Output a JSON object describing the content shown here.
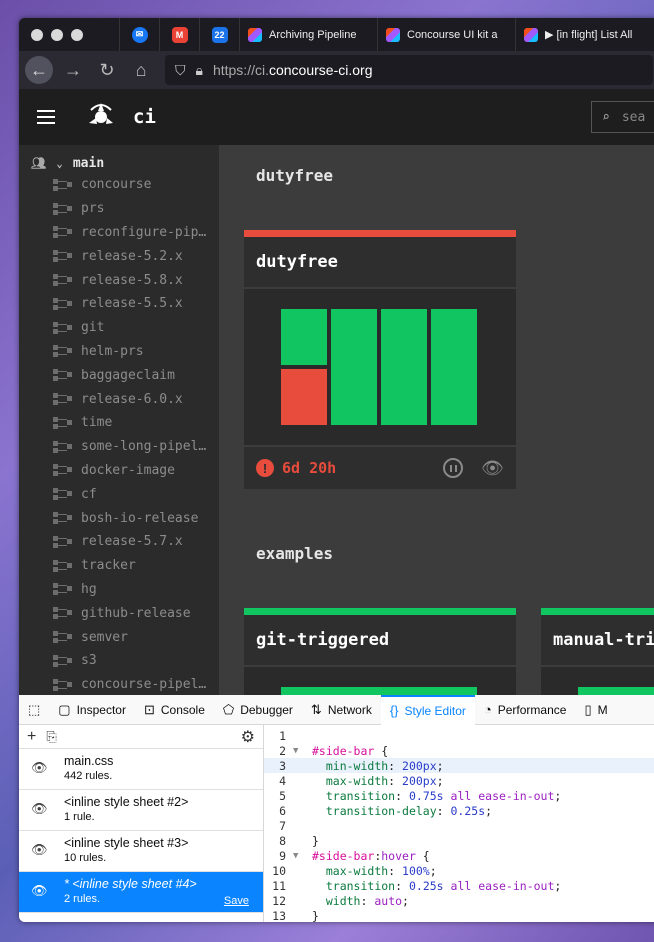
{
  "browser": {
    "tabs": [
      {
        "label": "Archiving Pipeline"
      },
      {
        "label": "Concourse UI kit a"
      },
      {
        "label": "▶ [in flight] List All"
      }
    ],
    "pinned": [
      {
        "icon": "messenger-icon",
        "color": "#1877f2"
      },
      {
        "icon": "gmail-icon",
        "color": "#ea4335"
      },
      {
        "icon": "calendar-icon",
        "color": "#1a73e8",
        "text": "22"
      }
    ],
    "url": {
      "protocol": "https://ci.",
      "host": "concourse-ci.org"
    }
  },
  "header": {
    "pipeline_name": "ci",
    "search_placeholder": "sea"
  },
  "sidebar": {
    "team": "main",
    "pipelines": [
      "concourse",
      "prs",
      "reconfigure-pip…",
      "release-5.2.x",
      "release-5.8.x",
      "release-5.5.x",
      "git",
      "helm-prs",
      "baggageclaim",
      "release-6.0.x",
      "time",
      "some-long-pipel…",
      "docker-image",
      "cf",
      "bosh-io-release",
      "release-5.7.x",
      "tracker",
      "hg",
      "github-release",
      "semver",
      "s3",
      "concourse-pipel…"
    ]
  },
  "groups": [
    {
      "title": "dutyfree",
      "cards": [
        {
          "name": "dutyfree",
          "status_color": "#e74c3c",
          "age": "6d 20h"
        }
      ]
    },
    {
      "title": "examples",
      "cards": [
        {
          "name": "git-triggered",
          "status_color": "#11c560"
        },
        {
          "name": "manual-tri",
          "status_color": "#11c560"
        }
      ]
    }
  ],
  "colors": {
    "succeeded": "#11c560",
    "failed": "#e74c3c"
  },
  "devtools": {
    "tabs": [
      {
        "label": "Inspector",
        "icon": "inspector-icon"
      },
      {
        "label": "Console",
        "icon": "console-icon"
      },
      {
        "label": "Debugger",
        "icon": "debugger-icon"
      },
      {
        "label": "Network",
        "icon": "network-icon"
      },
      {
        "label": "Style Editor",
        "icon": "style-editor-icon",
        "active": true
      },
      {
        "label": "Performance",
        "icon": "performance-icon"
      },
      {
        "label": "M",
        "icon": "memory-icon"
      }
    ],
    "sheets": [
      {
        "name": "main.css",
        "rules": "442 rules."
      },
      {
        "name": "<inline style sheet #2>",
        "rules": "1 rule."
      },
      {
        "name": "<inline style sheet #3>",
        "rules": "10 rules."
      },
      {
        "name": "* <inline style sheet #4>",
        "rules": "2 rules.",
        "selected": true,
        "save": "Save"
      }
    ],
    "code": [
      {
        "n": "1",
        "parts": []
      },
      {
        "n": "2",
        "fold": "▼",
        "parts": [
          [
            "sel",
            "#side-bar"
          ],
          [
            "pl",
            " {"
          ]
        ]
      },
      {
        "n": "3",
        "hl": true,
        "parts": [
          [
            "pl",
            "  "
          ],
          [
            "prop",
            "min-width"
          ],
          [
            "pl",
            ": "
          ],
          [
            "val",
            "200px"
          ],
          [
            "pl",
            ";"
          ]
        ]
      },
      {
        "n": "4",
        "parts": [
          [
            "pl",
            "  "
          ],
          [
            "prop",
            "max-width"
          ],
          [
            "pl",
            ": "
          ],
          [
            "val",
            "200px"
          ],
          [
            "pl",
            ";"
          ]
        ]
      },
      {
        "n": "5",
        "parts": [
          [
            "pl",
            "  "
          ],
          [
            "prop",
            "transition"
          ],
          [
            "pl",
            ": "
          ],
          [
            "val",
            "0.75s"
          ],
          [
            "pl",
            " "
          ],
          [
            "kw",
            "all ease-in-out"
          ],
          [
            "pl",
            ";"
          ]
        ]
      },
      {
        "n": "6",
        "parts": [
          [
            "pl",
            "  "
          ],
          [
            "prop",
            "transition-delay"
          ],
          [
            "pl",
            ": "
          ],
          [
            "val",
            "0.25s"
          ],
          [
            "pl",
            ";"
          ]
        ]
      },
      {
        "n": "7",
        "parts": []
      },
      {
        "n": "8",
        "parts": [
          [
            "pl",
            "}"
          ]
        ]
      },
      {
        "n": "9",
        "fold": "▼",
        "parts": [
          [
            "sel",
            "#side-bar"
          ],
          [
            "pl",
            ":"
          ],
          [
            "kw",
            "hover"
          ],
          [
            "pl",
            " {"
          ]
        ]
      },
      {
        "n": "10",
        "parts": [
          [
            "pl",
            "  "
          ],
          [
            "prop",
            "max-width"
          ],
          [
            "pl",
            ": "
          ],
          [
            "val",
            "100%"
          ],
          [
            "pl",
            ";"
          ]
        ]
      },
      {
        "n": "11",
        "parts": [
          [
            "pl",
            "  "
          ],
          [
            "prop",
            "transition"
          ],
          [
            "pl",
            ": "
          ],
          [
            "val",
            "0.25s"
          ],
          [
            "pl",
            " "
          ],
          [
            "kw",
            "all ease-in-out"
          ],
          [
            "pl",
            ";"
          ]
        ]
      },
      {
        "n": "12",
        "parts": [
          [
            "pl",
            "  "
          ],
          [
            "prop",
            "width"
          ],
          [
            "pl",
            ": "
          ],
          [
            "kw",
            "auto"
          ],
          [
            "pl",
            ";"
          ]
        ]
      },
      {
        "n": "13",
        "parts": [
          [
            "pl",
            "}"
          ]
        ]
      }
    ]
  }
}
